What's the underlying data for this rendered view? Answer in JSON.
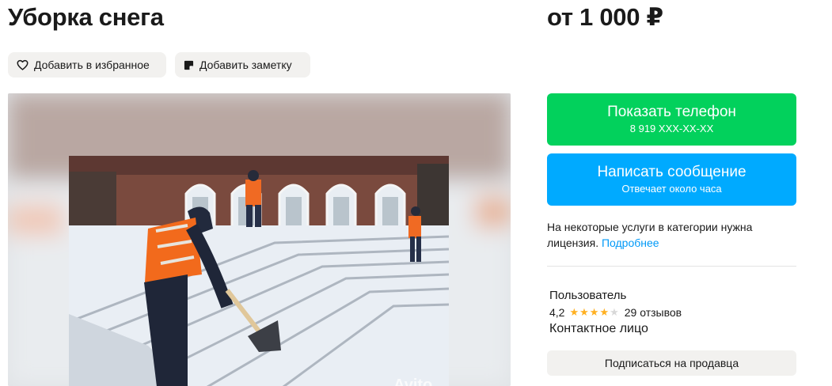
{
  "listing": {
    "title": "Уборка снега",
    "price": "от 1 000 ₽"
  },
  "actions": {
    "favorite_label": "Добавить в избранное",
    "favorite_icon": "heart-icon",
    "note_label": "Добавить заметку",
    "note_icon": "note-icon"
  },
  "contact_buttons": {
    "phone_label": "Показать телефон",
    "phone_number": "8 919 XXX-XX-XX",
    "message_label": "Написать сообщение",
    "message_sub": "Отвечает около часа",
    "phone_color": "#02d15c",
    "message_color": "#00aaff"
  },
  "license": {
    "text": "На некоторые услуги в категории нужна лицензия. ",
    "link": "Подробнее"
  },
  "seller": {
    "name": "Пользователь",
    "rating": "4,2",
    "rating_value": 4.2,
    "stars_total": 5,
    "reviews": "29 отзывов",
    "role": "Контактное лицо",
    "subscribe_label": "Подписаться на продавца"
  },
  "gallery": {
    "watermark": "Avito"
  }
}
